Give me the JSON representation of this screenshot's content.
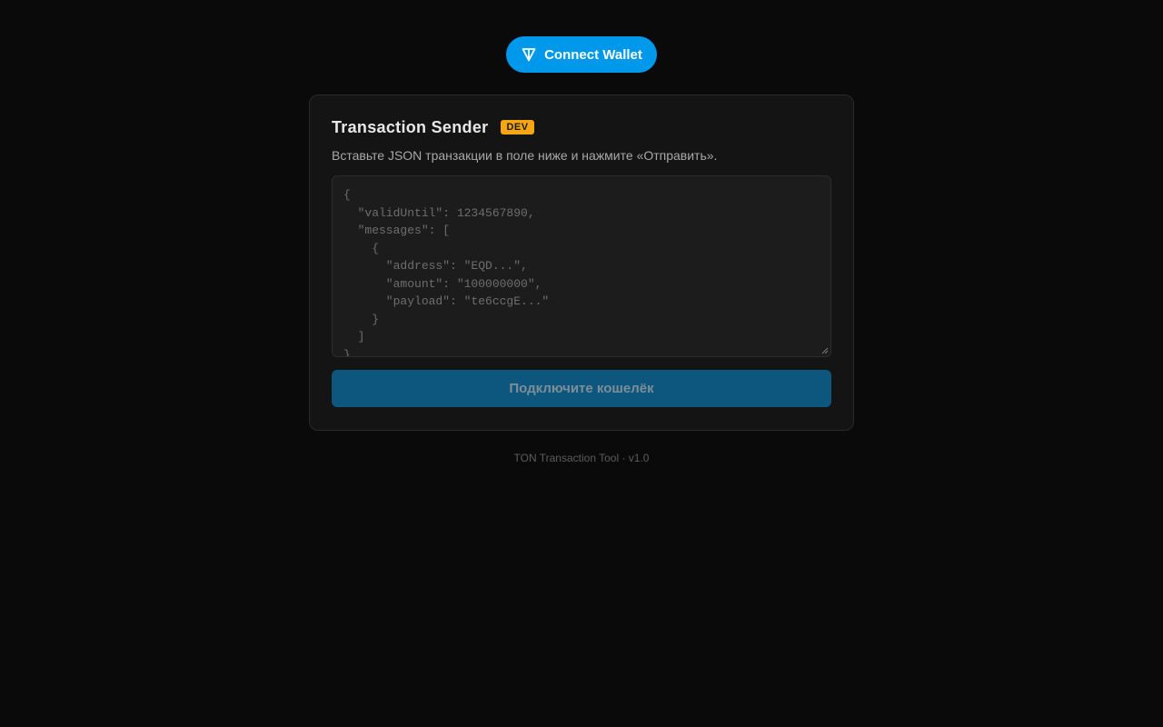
{
  "header": {
    "connect_label": "Connect Wallet",
    "connect_icon": "ton-diamond-icon",
    "accent": "#0098ea"
  },
  "card": {
    "title": "Transaction Sender",
    "badge": "DEV",
    "badge_color": "#f5a612",
    "description": "Вставьте JSON транзакции в поле ниже и нажмите «Отправить».",
    "editor_placeholder": "{\n  \"validUntil\": 1234567890,\n  \"messages\": [\n    {\n      \"address\": \"EQD...\",\n      \"amount\": \"100000000\",\n      \"payload\": \"te6ccgE...\"\n    }\n  ]\n}",
    "submit_label": "Подключите кошелёк"
  },
  "footer": {
    "text": "TON Transaction Tool · v1.0"
  }
}
